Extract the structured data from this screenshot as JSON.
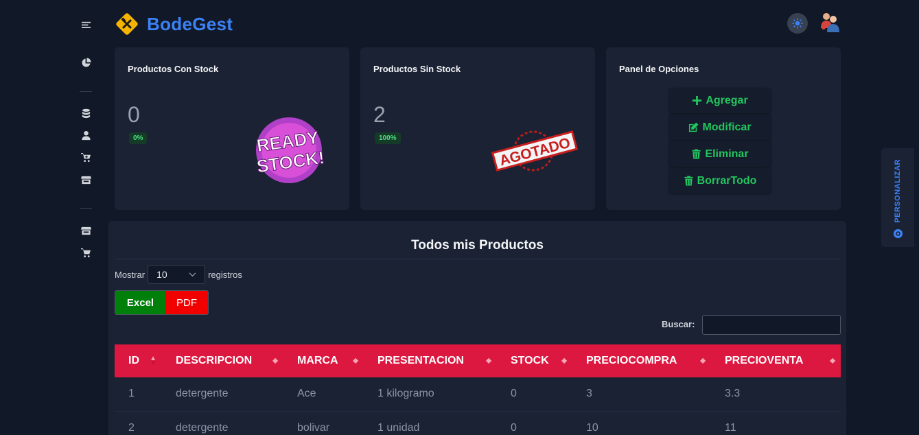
{
  "brand": {
    "name": "BodeGest"
  },
  "sidebar": {
    "icons": [
      "menu-icon",
      "chart-pie-icon",
      "database-icon",
      "user-icon",
      "cart-icon",
      "store-icon",
      "store-icon",
      "cart-icon"
    ]
  },
  "cards": {
    "con_stock": {
      "title": "Productos Con Stock",
      "value": "0",
      "badge": "0%"
    },
    "sin_stock": {
      "title": "Productos Sin Stock",
      "value": "2",
      "badge": "100%"
    },
    "opciones": {
      "title": "Panel de Opciones",
      "buttons": [
        "Agregar",
        "Modificar",
        "Eliminar",
        "BorrarTodo"
      ]
    }
  },
  "images": {
    "ready_stock": "READY STOCK!",
    "agotado": "AGOTADO"
  },
  "personalizar": {
    "label": "PERSONALIZAR"
  },
  "table_panel": {
    "title": "Todos mis Productos",
    "show_label": "Mostrar",
    "show_value": "10",
    "records_label": "registros",
    "excel": "Excel",
    "pdf": "PDF",
    "search_label": "Buscar:",
    "columns": [
      "ID",
      "DESCRIPCION",
      "MARCA",
      "PRESENTACION",
      "STOCK",
      "PRECIOCOMPRA",
      "PRECIOVENTA"
    ],
    "rows": [
      [
        "1",
        "detergente",
        "Ace",
        "1 kilogramo",
        "0",
        "3",
        "3.3"
      ],
      [
        "2",
        "detergente",
        "bolivar",
        "1 unidad",
        "0",
        "10",
        "11"
      ]
    ]
  },
  "colors": {
    "accent": "#3b82f6",
    "table_header": "#dc1740",
    "success": "#22c55e",
    "excel": "#00800a",
    "pdf": "#f20000"
  }
}
